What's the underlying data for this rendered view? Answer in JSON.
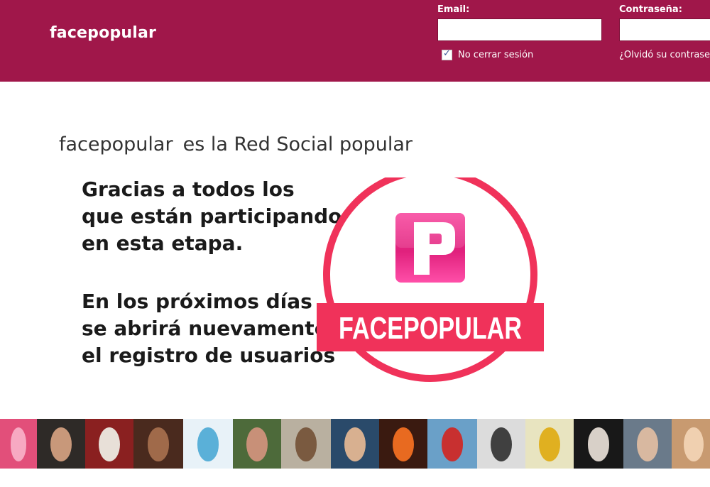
{
  "header": {
    "brand": "facepopular",
    "email_label": "Email:",
    "email_value": "",
    "password_label": "Contraseña:",
    "password_value": "",
    "keep_logged_in_label": "No cerrar sesión",
    "keep_logged_in_checked": true,
    "forgot_label": "¿Olvidó su contrase"
  },
  "main": {
    "tagline_brand": "facepopular",
    "tagline_rest": "es la Red Social popular",
    "message_lines_1": [
      "Gracias a todos los",
      "que están participando",
      "en esta etapa."
    ],
    "message_lines_2": [
      "En los próximos días",
      "se abrirá nuevamente",
      "el registro de usuarios"
    ]
  },
  "logo": {
    "text": "FACEPOPULAR",
    "letter": "P",
    "ring_color": "#f0325a",
    "band_color": "#f0325a",
    "icon_color": "#f0268c"
  },
  "colors": {
    "header_bg": "#a0174a",
    "text_dark": "#1a1a1a"
  },
  "photo_strip": [
    {
      "name": "pink-flower-photo",
      "bg": "#e24f7a",
      "fg": "#f7a9c2"
    },
    {
      "name": "man-long-hair-photo",
      "bg": "#2e2a27",
      "fg": "#c8987a"
    },
    {
      "name": "man-white-shirt-photo",
      "bg": "#8a2020",
      "fg": "#e8e0d8"
    },
    {
      "name": "man-bearded-photo",
      "bg": "#4a2a1e",
      "fg": "#a06a4a"
    },
    {
      "name": "foro-banner-photo",
      "bg": "#e8f2f8",
      "fg": "#5ab0d8"
    },
    {
      "name": "man-green-photo",
      "bg": "#4d6a3a",
      "fg": "#c89078"
    },
    {
      "name": "guitar-player-photo",
      "bg": "#b9b0a0",
      "fg": "#7a5a40"
    },
    {
      "name": "man-round-face-photo",
      "bg": "#2a4a6a",
      "fg": "#d8b090"
    },
    {
      "name": "fire-stage-photo",
      "bg": "#3a1a10",
      "fg": "#e86a20"
    },
    {
      "name": "beach-photo",
      "bg": "#6aa0c8",
      "fg": "#c83030"
    },
    {
      "name": "woman-bw-photo",
      "bg": "#dcdcdc",
      "fg": "#404040"
    },
    {
      "name": "caricature-photo",
      "bg": "#e8e4c0",
      "fg": "#e0b020"
    },
    {
      "name": "woman-dark-hair-photo",
      "bg": "#181818",
      "fg": "#d8d0c8"
    },
    {
      "name": "man-shouting-photo",
      "bg": "#6a7a8a",
      "fg": "#d8b8a0"
    },
    {
      "name": "woman-blonde-photo",
      "bg": "#c89a70",
      "fg": "#f0d0b0"
    }
  ]
}
